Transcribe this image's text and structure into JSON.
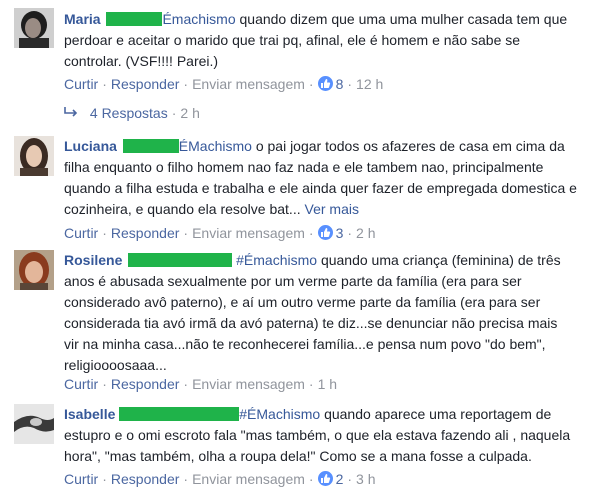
{
  "comments": [
    {
      "author": "Maria",
      "lines": [
        [
          "Émachismo",
          " quando dizem que uma uma mulher casada tem que"
        ],
        "perdoar e aceitar o marido que trai pq, afinal, ele é homem e não sabe se",
        "controlar. (VSF!!!! Parei.)"
      ],
      "likes": "8",
      "time": "12 h",
      "replies": "4 Respostas",
      "replies_time": "2 h"
    },
    {
      "author": "Luciana",
      "lines": [
        [
          "ÉMachismo",
          " o pai jogar todos os afazeres de casa em cima da"
        ],
        "filha enquanto o filho homem nao faz nada e ele tambem nao, principalmente",
        "quando a filha estuda e trabalha e ele ainda quer fazer de empregada domestica e",
        "cozinheira, e quando ela resolve bat..."
      ],
      "see_more": "Ver mais",
      "likes": "3",
      "time": "2 h"
    },
    {
      "author": "Rosilene",
      "lines": [
        [
          "#Émachismo",
          " quando uma criança (feminina) de três"
        ],
        "anos é abusada sexualmente por um verme parte da família (era para ser",
        "considerado avô paterno), e aí um outro verme parte da família (era para ser",
        "considerada tia avó irmã da avó paterna) te diz...se denunciar não precisa mais",
        "vir na minha casa...não te reconhecerei família...e pensa num povo \"do bem\",",
        "religioooosaaa..."
      ],
      "time": "1 h"
    },
    {
      "author": "Isabelle",
      "lines": [
        [
          "#ÉMachismo",
          " quando aparece uma reportagem de"
        ],
        "estupro e o omi escroto fala \"mas também, o que ela estava fazendo ali , naquela",
        "hora\", \"mas também, olha a roupa dela!\" Como se a mana fosse a culpada."
      ],
      "likes": "2",
      "time": "3 h"
    }
  ],
  "actions": {
    "like": "Curtir",
    "reply": "Responder",
    "message": "Enviar mensagem",
    "sep": "·"
  }
}
